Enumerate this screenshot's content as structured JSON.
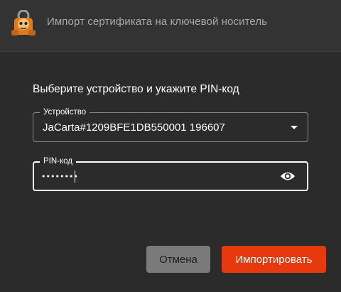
{
  "window": {
    "title": "Импорт сертификата на ключевой носитель",
    "logo_icon": "app-logo-icon"
  },
  "form": {
    "heading": "Выберите устройство и укажите PIN-код",
    "device": {
      "label": "Устройство",
      "value": "JaCarta#1209BFE1DB550001 196607",
      "icon": "dropdown-arrow-icon"
    },
    "pin": {
      "label": "PIN-код",
      "value": "••••••••",
      "icon": "eye-icon"
    }
  },
  "actions": {
    "cancel_label": "Отмена",
    "import_label": "Импортировать"
  },
  "colors": {
    "background": "#2b2b2b",
    "titlebar": "#333333",
    "accent": "#e8380d",
    "cancel_button": "#7a7a7a"
  }
}
